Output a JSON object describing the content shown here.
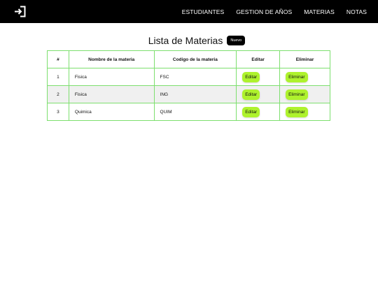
{
  "nav": {
    "links": [
      "ESTUDIANTES",
      "GESTION DE AÑOS",
      "MATERIAS",
      "NOTAS"
    ]
  },
  "page": {
    "title": "Lista de Materias",
    "new_button": "Nuevo"
  },
  "table": {
    "headers": [
      "#",
      "Nombre de la materia",
      "Codigo de la materia",
      "Editar",
      "Eliminar"
    ],
    "rows": [
      {
        "num": "1",
        "name": "Fisica",
        "code": "FSC",
        "edit": "Editar",
        "delete": "Eliminar"
      },
      {
        "num": "2",
        "name": "Fisica",
        "code": "ING",
        "edit": "Editar",
        "delete": "Eliminar"
      },
      {
        "num": "3",
        "name": "Quimica",
        "code": "QUIM",
        "edit": "Editar",
        "delete": "Eliminar"
      }
    ]
  },
  "colors": {
    "navbar": "#000000",
    "table_border": "#7ddf6e",
    "button_green": "#aef22d",
    "row_alt": "#f0f0f0"
  },
  "icons": {
    "logout": "logout-icon"
  }
}
